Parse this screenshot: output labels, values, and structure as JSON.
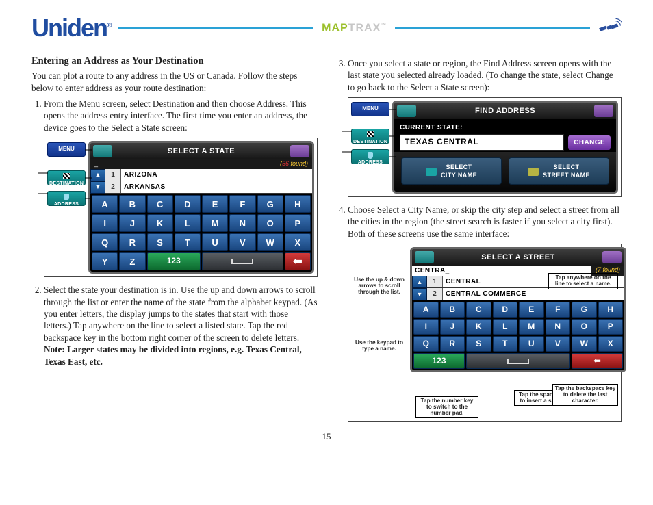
{
  "header": {
    "brand": "Uniden",
    "product_a": "MAP",
    "product_b": "TRAX"
  },
  "left": {
    "heading": "Entering an Address as Your Destination",
    "intro": "You can plot a route to any address in the US or Canada. Follow the steps below to enter address as your route destination:",
    "step1": "From the Menu screen, select Destination and then choose Address. This opens the address entry interface. The first time you enter an address, the device goes to the Select a State screen:",
    "step2": "Select the state your destination is in. Use the up and down arrows to scroll through the list or enter the name of the state from the alphabet keypad. (As you enter letters, the display jumps to the states that start with those letters.) Tap anywhere on the line to select a listed state. Tap the red backspace key in the bottom right corner of the screen to delete letters.",
    "note": "Note: Larger states may be divided into regions, e.g. Texas Central, Texas East, etc."
  },
  "right": {
    "step3": "Once you select a state or region, the Find Address screen opens with the last state you selected already loaded. (To change the state, select Change to go back to the Select a  State screen):",
    "step4": "Choose Select a City Name, or skip the city step and select a street from all the cities in the region (the street search is faster if you select a city first). Both of these screens use the same interface:"
  },
  "nav": {
    "menu": "MENU",
    "destination": "DESTINATION",
    "address": "ADDRESS"
  },
  "dev1": {
    "title": "SELECT A STATE",
    "cursor": "_",
    "found_prefix": "(",
    "found_suffix": " found)",
    "rows": [
      {
        "n": "1",
        "v": "ARIZONA"
      },
      {
        "n": "2",
        "v": "ARKANSAS"
      }
    ],
    "keys": [
      "A",
      "B",
      "C",
      "D",
      "E",
      "F",
      "G",
      "H",
      "I",
      "J",
      "K",
      "L",
      "M",
      "N",
      "O",
      "P",
      "Q",
      "R",
      "S",
      "T",
      "U",
      "V",
      "W",
      "X",
      "Y",
      "Z"
    ],
    "numkey": "123"
  },
  "dev2": {
    "title": "FIND ADDRESS",
    "curstate_lbl": "CURRENT STATE:",
    "curstate_val": "TEXAS CENTRAL",
    "change": "CHANGE",
    "sel_city": "SELECT\nCITY NAME",
    "sel_street": "SELECT\nSTREET NAME"
  },
  "dev3": {
    "title": "SELECT A STREET",
    "input": "CENTRA_",
    "found": "(7 found)",
    "rows": [
      {
        "n": "1",
        "v": "CENTRAL"
      },
      {
        "n": "2",
        "v": "CENTRAL COMMERCE"
      }
    ],
    "keys": [
      "A",
      "B",
      "C",
      "D",
      "E",
      "F",
      "G",
      "H",
      "I",
      "J",
      "K",
      "L",
      "M",
      "N",
      "O",
      "P",
      "Q",
      "R",
      "S",
      "T"
    ],
    "numkey": "123"
  },
  "ann": {
    "scroll": "Use the up & down arrows to scroll through the list.",
    "tapline": "Tap anywhere on the line to select a name.",
    "keypad": "Use the keypad to type a name.",
    "numpad": "Tap the number key to switch to the number pad.",
    "space": "Tap the space key to insert a space.",
    "back": "Tap the backspace key to delete the last character."
  },
  "page_number": "15"
}
